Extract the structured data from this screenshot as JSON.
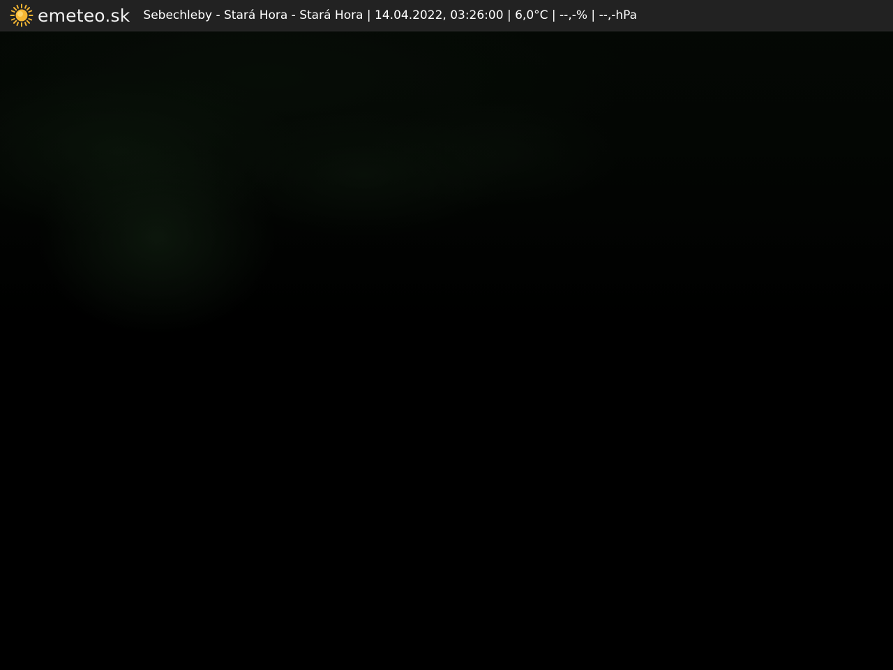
{
  "brand": {
    "name": "emeteo.sk",
    "icon": "sun-icon",
    "icon_color": "#f7b733"
  },
  "caption": {
    "location": "Sebechleby - Stará Hora - Stará Hora",
    "datetime": "14.04.2022, 03:26:00",
    "temperature": "6,0°C",
    "humidity": "--,-%",
    "pressure": "--,-hPa",
    "separator": " | "
  },
  "colors": {
    "topbar_background": "#222222",
    "image_background": "#000000"
  }
}
